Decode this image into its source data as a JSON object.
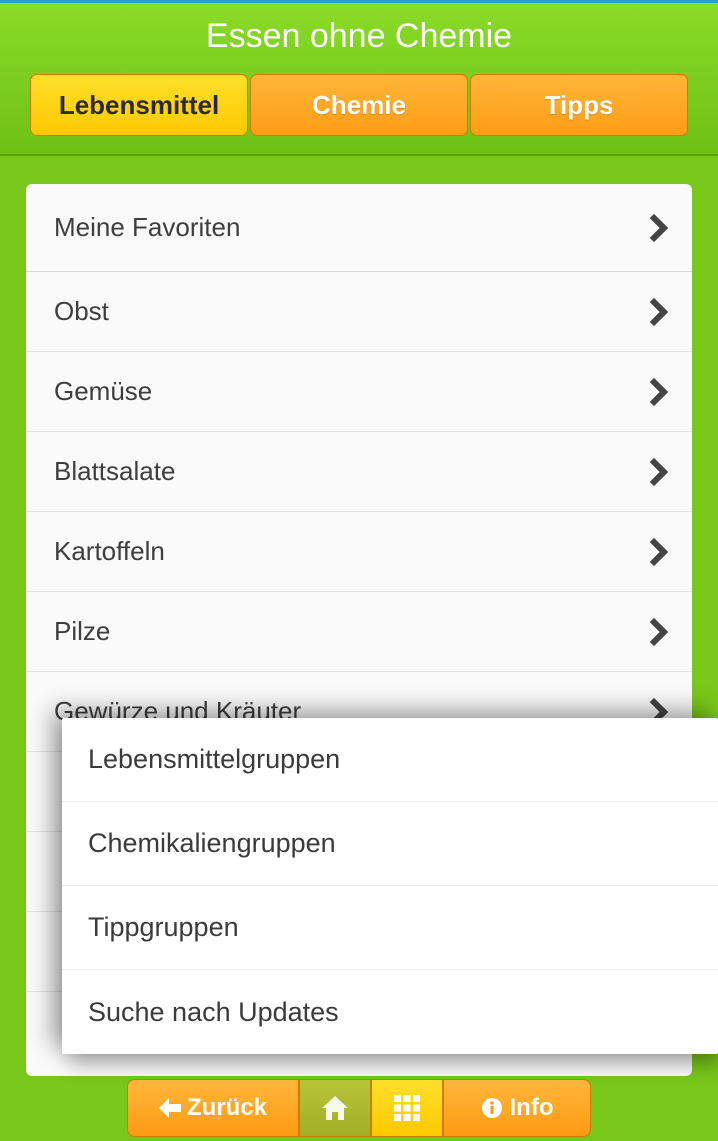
{
  "header": {
    "title": "Essen ohne Chemie",
    "tabs": [
      {
        "label": "Lebensmittel",
        "active": true
      },
      {
        "label": "Chemie",
        "active": false
      },
      {
        "label": "Tipps",
        "active": false
      }
    ]
  },
  "list": {
    "items": [
      {
        "label": "Meine Favoriten"
      },
      {
        "label": "Obst"
      },
      {
        "label": "Gemüse"
      },
      {
        "label": "Blattsalate"
      },
      {
        "label": "Kartoffeln"
      },
      {
        "label": "Pilze"
      },
      {
        "label": "Gewürze und Kräuter"
      },
      {
        "label": ""
      },
      {
        "label": ""
      },
      {
        "label": ""
      }
    ]
  },
  "popup": {
    "items": [
      {
        "label": "Lebensmittelgruppen"
      },
      {
        "label": "Chemikaliengruppen"
      },
      {
        "label": "Tippgruppen"
      },
      {
        "label": "Suche nach Updates"
      }
    ]
  },
  "bottombar": {
    "back": "Zurück",
    "info": "Info"
  }
}
